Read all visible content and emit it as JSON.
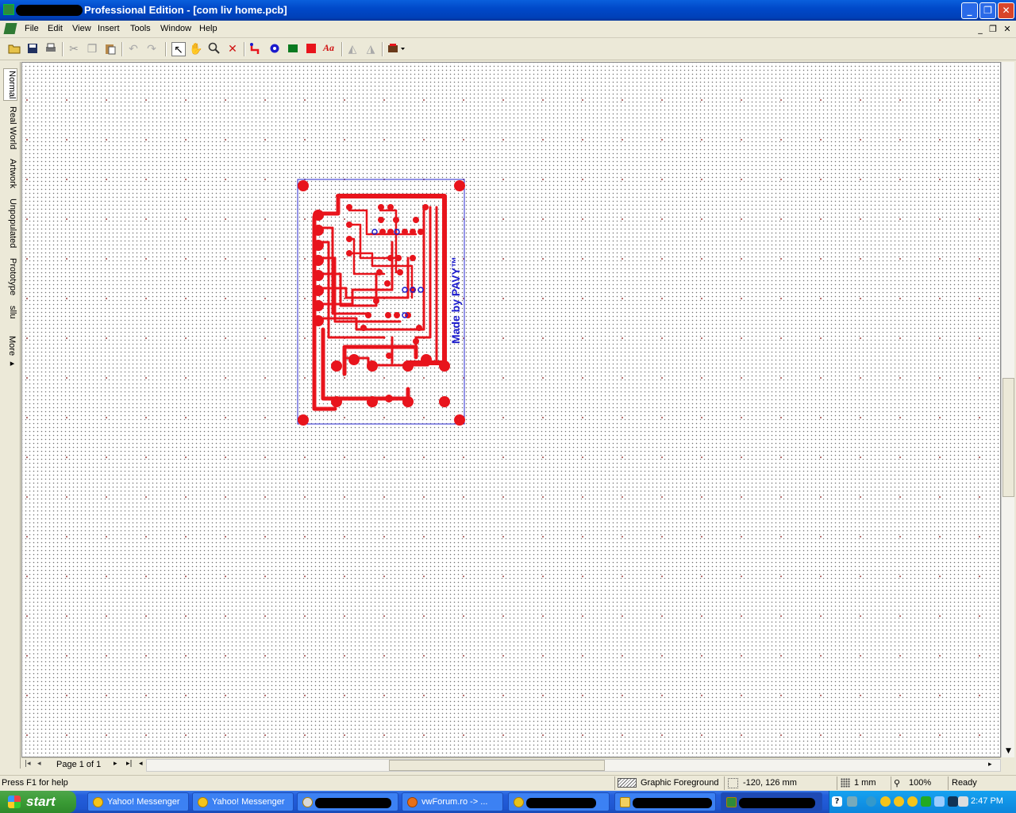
{
  "window": {
    "title": "Professional Edition - [com liv home.pcb]",
    "controls": {
      "minimize": "_",
      "maximize": "❐",
      "close": "✕"
    }
  },
  "menu": {
    "items": [
      "File",
      "Edit",
      "View",
      "Insert",
      "Tools",
      "Window",
      "Help"
    ],
    "mdi_controls": {
      "minimize": "_",
      "restore": "❐",
      "close": "✕"
    }
  },
  "toolbar": {
    "icons": [
      "open-icon",
      "save-icon",
      "print-icon",
      "cut-icon",
      "copy-icon",
      "paste-icon",
      "undo-icon",
      "redo-icon",
      "pointer-icon",
      "pan-hand-icon",
      "zoom-icon",
      "delete-icon",
      "track-icon",
      "via-icon",
      "pad-icon",
      "area-icon",
      "text-icon",
      "mirror-left-icon",
      "mirror-right-icon",
      "component-icon"
    ],
    "text_tool_label": "Aa"
  },
  "view_tabs": [
    "Normal",
    "Real World",
    "Artwork",
    "Unpopulated",
    "Prototype",
    "sllu",
    "More ▸"
  ],
  "board": {
    "silkscreen_text": "Made by PAVY™",
    "copper_color": "#e8141c",
    "accent_color": "#1a1acc",
    "hole_pairs": [
      [
        "#e8141c",
        "#1a1acc"
      ]
    ]
  },
  "pagination": {
    "label": "Page 1 of 1",
    "first": "|◂",
    "prev": "◂",
    "next": "▸",
    "last": "▸|",
    "scroll_left": "◂",
    "scroll_right": "▸"
  },
  "status": {
    "help": "Press F1 for help",
    "layer": "Graphic Foreground",
    "coords": "-120, 126 mm",
    "grid": "1 mm",
    "zoom": "100%",
    "state": "Ready"
  },
  "taskbar": {
    "start_label": "start",
    "tasks": [
      {
        "label": "Yahoo! Messenger",
        "redacted": false
      },
      {
        "label": "Yahoo! Messenger",
        "redacted": false
      },
      {
        "label": "",
        "redacted": true
      },
      {
        "label": "vwForum.ro -> ...",
        "redacted": false
      },
      {
        "label": "",
        "redacted": true
      },
      {
        "label": "",
        "redacted": true
      },
      {
        "label": "",
        "redacted": true
      }
    ],
    "clock": "2:47 PM"
  }
}
